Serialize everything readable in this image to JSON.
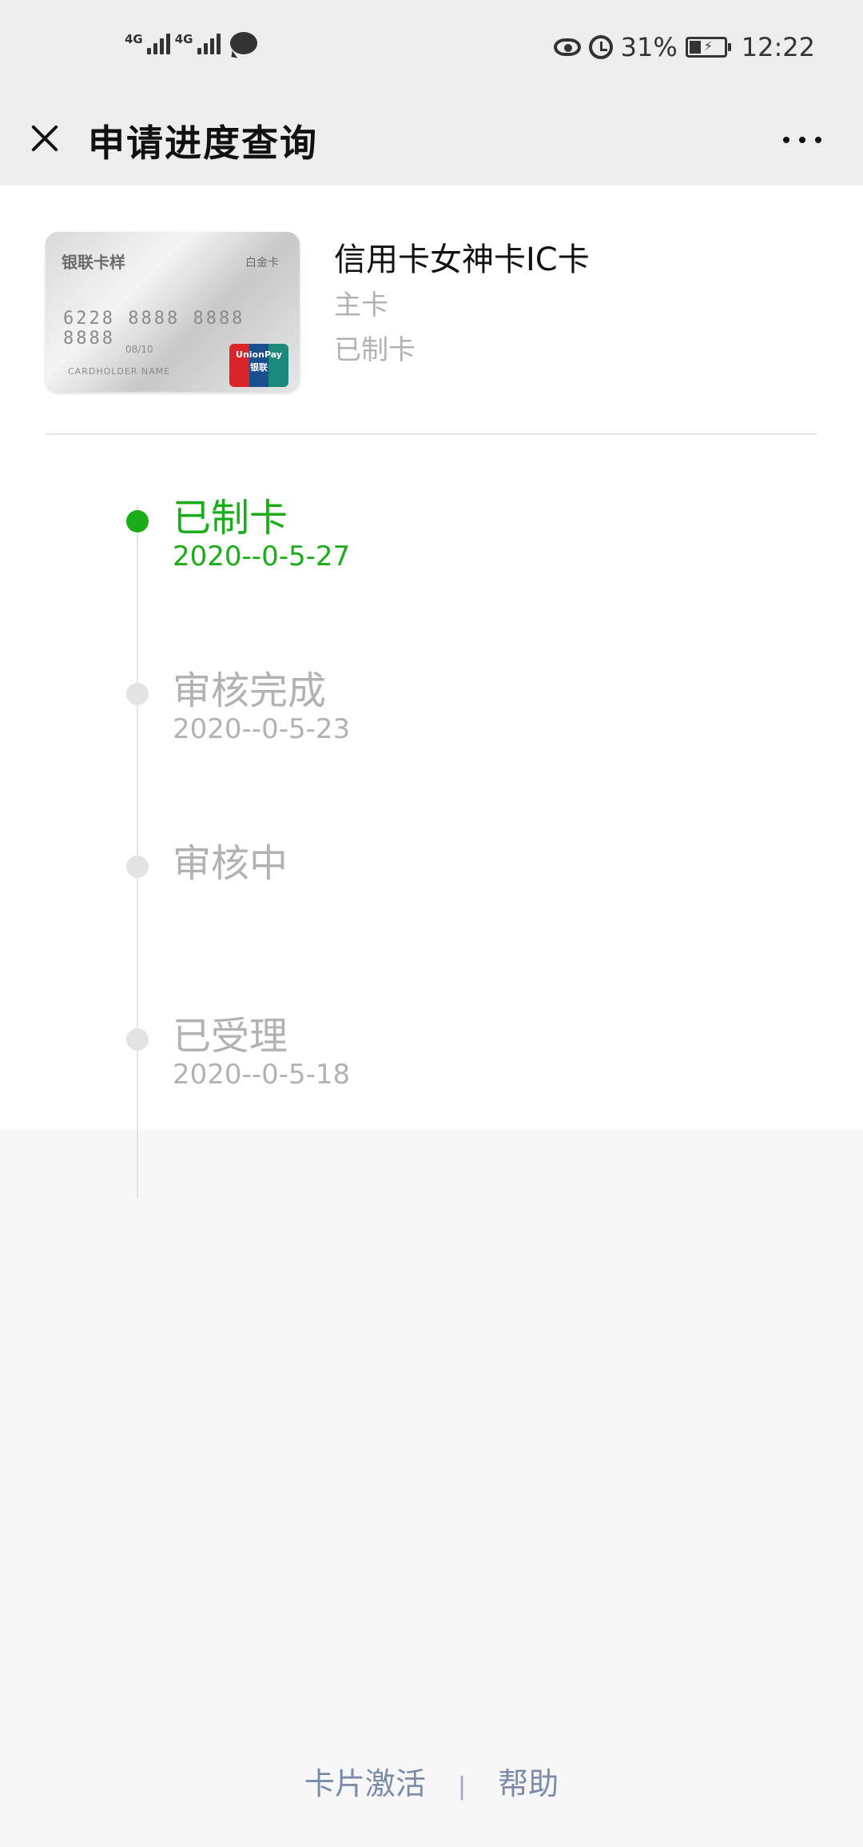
{
  "status_bar": {
    "network_1": "4G",
    "network_2": "4G",
    "battery": "31%",
    "time": "12:22"
  },
  "header": {
    "title": "申请进度查询"
  },
  "card": {
    "image_brand": "银联卡样",
    "image_tier": "白金卡",
    "image_number": "6228 8888 8888 8888",
    "image_valid": "08/10",
    "image_holder": "CARDHOLDER NAME",
    "image_logo_text": "UnionPay 银联",
    "name": "信用卡女神卡IC卡",
    "type": "主卡",
    "status": "已制卡"
  },
  "timeline": [
    {
      "label": "已制卡",
      "date": "2020--0-5-27",
      "active": true
    },
    {
      "label": "审核完成",
      "date": "2020--0-5-23",
      "active": false
    },
    {
      "label": "审核中",
      "date": "",
      "active": false
    },
    {
      "label": "已受理",
      "date": "2020--0-5-18",
      "active": false
    }
  ],
  "footer": {
    "activate": "卡片激活",
    "separator": "|",
    "help": "帮助"
  },
  "colors": {
    "accent_green": "#1aad19",
    "muted_gray": "#b2b2b2",
    "link_blue": "#7b8ba8"
  }
}
